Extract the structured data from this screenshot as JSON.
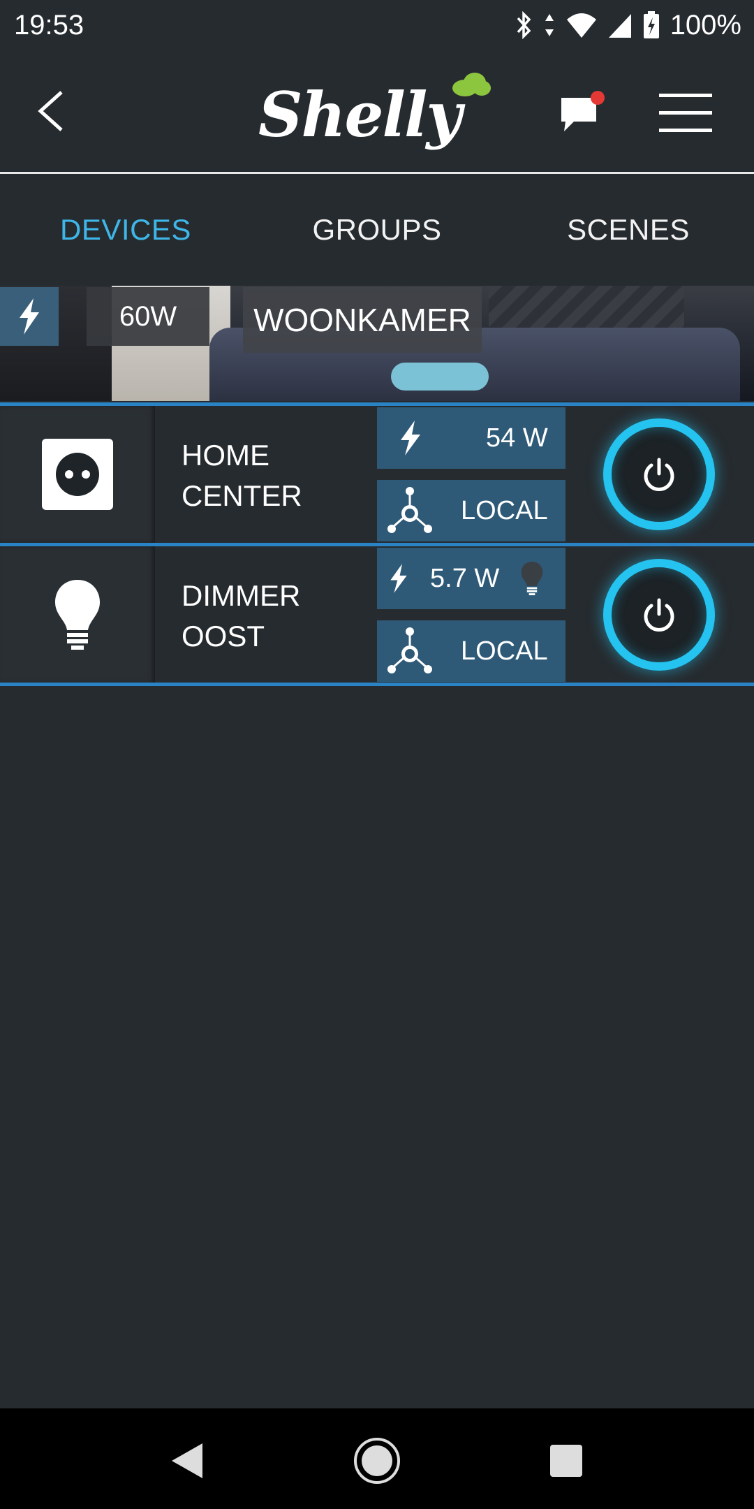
{
  "status_bar": {
    "time": "19:53",
    "battery_percent": "100%",
    "icons": [
      "bluetooth-icon",
      "data-arrows-icon",
      "wifi-icon",
      "signal-icon",
      "battery-charging-icon"
    ]
  },
  "app_bar": {
    "logo_text": "Shelly",
    "back_icon": "back-chevron-icon",
    "chat_icon": "chat-notification-icon",
    "menu_icon": "hamburger-menu-icon"
  },
  "tabs": [
    {
      "label": "DEVICES",
      "active": true
    },
    {
      "label": "GROUPS",
      "active": false
    },
    {
      "label": "SCENES",
      "active": false
    }
  ],
  "room": {
    "power": "60W",
    "name": "WOONKAMER"
  },
  "devices": [
    {
      "name_line1": "HOME",
      "name_line2": "CENTER",
      "type_icon": "plug-socket-icon",
      "power": "54 W",
      "connection": "LOCAL",
      "on": true
    },
    {
      "name_line1": "DIMMER",
      "name_line2": "OOST",
      "type_icon": "light-bulb-icon",
      "power": "5.7 W",
      "connection": "LOCAL",
      "on": true
    }
  ],
  "colors": {
    "accent": "#3fb6e8",
    "ring": "#25c3f0",
    "divider": "#2a83c4",
    "info_bg": "#2e5a78",
    "background": "#262b2f",
    "notification_dot": "#e53935",
    "logo_cloud": "#8cc63f"
  }
}
